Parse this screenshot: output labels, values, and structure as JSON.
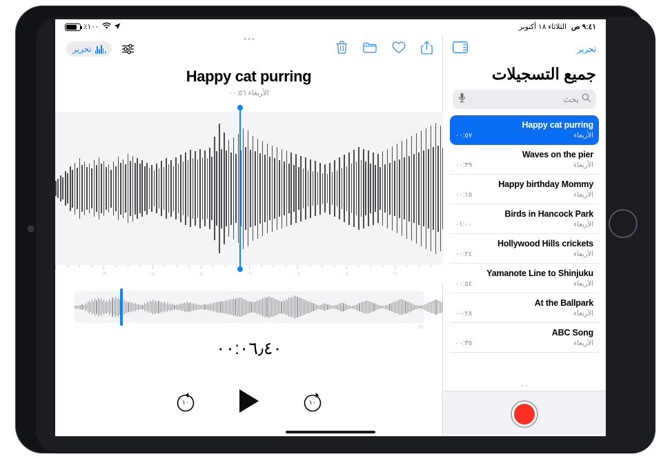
{
  "statusbar": {
    "battery_pct": "٪١٠٠",
    "wifi_icon": "wifi-icon",
    "location_icon": "location-arrow-icon",
    "date": "الثلاثاء ١٨ أكتوبر",
    "time": "٩:٤١ ص"
  },
  "player": {
    "edit_label": "تحرير",
    "edit_icon": "waveform-icon",
    "settings_icon": "audio-sliders-icon",
    "toolbar_icons": [
      {
        "name": "trash-icon",
        "label": "حذف"
      },
      {
        "name": "folder-icon",
        "label": "مجلد"
      },
      {
        "name": "heart-icon",
        "label": "مفضلة"
      },
      {
        "name": "share-icon",
        "label": "مشاركة"
      }
    ],
    "title": "Happy cat purring",
    "subtitle": "الأربعاء ٠٠:٥٦",
    "current_time": "٠٠:٠٦٫٤٠",
    "ruler_labels": [
      ":٠٣",
      ":٠٤",
      ":٠٥",
      ":٠٦",
      ":٠٧",
      ":٠٨",
      ":٠٩"
    ],
    "mini_start": "٠:٠٠",
    "mini_end": "٠:٥٦",
    "skip_back_label": "١٠",
    "skip_forward_label": "١٠",
    "play_icon": "play-icon",
    "skip_back_icon": "skip-back-10-icon",
    "skip_forward_icon": "skip-forward-10-icon",
    "playhead_pct": 47.5,
    "mini_playhead_pct": 13.0,
    "accent_color": "#0a84ff"
  },
  "sidebar": {
    "edit_label": "تحرير",
    "sidebar_toggle_icon": "sidebar-toggle-icon",
    "title": "جميع التسجيلات",
    "search_placeholder": "بحث",
    "search_icon": "search-icon",
    "dictate_icon": "microphone-icon",
    "record_button_label": "تسجيل",
    "record_color": "#fc3022",
    "selected_index": 0,
    "recordings": [
      {
        "name": "Happy cat purring",
        "day": "الأربعاء",
        "duration": "٠٠:٥٧"
      },
      {
        "name": "Waves on the pier",
        "day": "الأربعاء",
        "duration": "٠٠:٣٩"
      },
      {
        "name": "Happy birthday Mommy",
        "day": "الأربعاء",
        "duration": "٠٠:١٥"
      },
      {
        "name": "Birds in Hancock Park",
        "day": "الأربعاء",
        "duration": "٠١:٠٠"
      },
      {
        "name": "Hollywood Hills crickets",
        "day": "الأربعاء",
        "duration": "٠٠:٢٤"
      },
      {
        "name": "Yamanote Line to Shinjuku",
        "day": "الأربعاء",
        "duration": "٠٠:٥٤"
      },
      {
        "name": "At the Ballpark",
        "day": "الأربعاء",
        "duration": "٠٠:٢٨"
      },
      {
        "name": "ABC Song",
        "day": "الأربعاء",
        "duration": "٠٠:٣٥"
      }
    ]
  },
  "waveform": {
    "main_bars": [
      18,
      22,
      30,
      26,
      40,
      35,
      52,
      44,
      60,
      48,
      70,
      55,
      62,
      50,
      58,
      46,
      66,
      54,
      72,
      58,
      64,
      50,
      56,
      44,
      62,
      52,
      74,
      60,
      68,
      56,
      80,
      64,
      76,
      60,
      70,
      58,
      66,
      52,
      60,
      48,
      54,
      42,
      58,
      46,
      64,
      50,
      70,
      56,
      66,
      52,
      72,
      58,
      78,
      62,
      84,
      66,
      90,
      70,
      86,
      68,
      92,
      72,
      88,
      70,
      94,
      74,
      120,
      86,
      150,
      92,
      130,
      88,
      112,
      84,
      118,
      80,
      126,
      88,
      140,
      96,
      134,
      90,
      122,
      86,
      116,
      82,
      110,
      78,
      104,
      74,
      100,
      70,
      96,
      66,
      92,
      62,
      88,
      58,
      84,
      54,
      80,
      50,
      76,
      46,
      72,
      42,
      68,
      40,
      64,
      38,
      60,
      36,
      56,
      34,
      60,
      38,
      66,
      42,
      72,
      48,
      78,
      52,
      84,
      58,
      90,
      62,
      96,
      66,
      92,
      62,
      88,
      58,
      84,
      54,
      80,
      50,
      86,
      56,
      92,
      60,
      98,
      64,
      104,
      68,
      110,
      72,
      116,
      76,
      122,
      80,
      128,
      84,
      134,
      88,
      140,
      92,
      146,
      96,
      152,
      100,
      146,
      94,
      140,
      90,
      134,
      86,
      128,
      82,
      122,
      78,
      116,
      74,
      110,
      70,
      104,
      66,
      98,
      62,
      92,
      58,
      86,
      54,
      80,
      50,
      74,
      46,
      68,
      42,
      62,
      38,
      56,
      34,
      50,
      30,
      44,
      28,
      40,
      26,
      36,
      24,
      40,
      28,
      46,
      32,
      52,
      36,
      58,
      40,
      64,
      44,
      70,
      48,
      76,
      52,
      82,
      56,
      88,
      60,
      94,
      64,
      100,
      68,
      106,
      72,
      112,
      76,
      118,
      80,
      124,
      84,
      130,
      88,
      136,
      92,
      142,
      96,
      148,
      100,
      154,
      104,
      160,
      108,
      154,
      102,
      148,
      98,
      142,
      94,
      136,
      90,
      130,
      86,
      124,
      82,
      118,
      78,
      112,
      74,
      106,
      70,
      100,
      66,
      94,
      62,
      88,
      58,
      82,
      54,
      76,
      50,
      70,
      46,
      64,
      42,
      58,
      38,
      52,
      34,
      46,
      30,
      40,
      28,
      36,
      24,
      32,
      22,
      28,
      20,
      34,
      24,
      40,
      28,
      46,
      32,
      52,
      36,
      58,
      40,
      64,
      44,
      70,
      48,
      76,
      52,
      82,
      56,
      88,
      60,
      94,
      64,
      88,
      58,
      82,
      54,
      76,
      50,
      70,
      46,
      64,
      42,
      58,
      38,
      52,
      34,
      46,
      30,
      40,
      26,
      34,
      22,
      28,
      20,
      24,
      18,
      30,
      22,
      36,
      26,
      42,
      30,
      48,
      34,
      54,
      38,
      60,
      42,
      66,
      46,
      72,
      50,
      78,
      54,
      84,
      58,
      90,
      62,
      96,
      66,
      102,
      70,
      108,
      74,
      114,
      78,
      120,
      82,
      126,
      86,
      132,
      90,
      138,
      94,
      144,
      98,
      138,
      92,
      132,
      88,
      126,
      84,
      120,
      80,
      114,
      76,
      108,
      72,
      102,
      68,
      96,
      64,
      90,
      60,
      84,
      56,
      78,
      52,
      72,
      48,
      66,
      44,
      60,
      40,
      54,
      36,
      48,
      32,
      42,
      28,
      36,
      24,
      30,
      20,
      26,
      18,
      32,
      22,
      38,
      26,
      44,
      30,
      50,
      34,
      56,
      38,
      62,
      42,
      68,
      46,
      74,
      50,
      80,
      54,
      86,
      58,
      92,
      62,
      98,
      66,
      104,
      70,
      110,
      74,
      116,
      78,
      122,
      82,
      128,
      86,
      134,
      90,
      140,
      94,
      150,
      100,
      144,
      96,
      138,
      92,
      132,
      88,
      126,
      84,
      120,
      80,
      114,
      76,
      108,
      72,
      102,
      68,
      96,
      64,
      90,
      60,
      84,
      56,
      78,
      52,
      72,
      48,
      66,
      44,
      60,
      40,
      54,
      36,
      48,
      32,
      42,
      28,
      36,
      24,
      30,
      22,
      26,
      18,
      22,
      16,
      28,
      20,
      34,
      24,
      40,
      28,
      46,
      32,
      52,
      36,
      58,
      40,
      64,
      44,
      70,
      48,
      76,
      52,
      82,
      56,
      88,
      60,
      94,
      64,
      100,
      68,
      106,
      72,
      112,
      76,
      118,
      80,
      124,
      84,
      118,
      80,
      112,
      76,
      106,
      72,
      100,
      68,
      94,
      64,
      88,
      60,
      82,
      56,
      76,
      52,
      70,
      48,
      64,
      44,
      58,
      40,
      52,
      36,
      46,
      32,
      40,
      28
    ],
    "mini_bars": [
      4,
      6,
      5,
      8,
      6,
      10,
      8,
      14,
      10,
      18,
      22,
      16,
      26,
      20,
      30,
      24,
      34,
      26,
      30,
      22,
      26,
      20,
      24,
      18,
      28,
      22,
      32,
      26,
      36,
      28,
      34,
      26,
      30,
      24,
      26,
      20,
      22,
      16,
      18,
      14,
      16,
      12,
      14,
      10,
      12,
      8,
      10,
      8,
      14,
      12,
      18,
      14,
      22,
      18,
      26,
      20,
      24,
      18,
      22,
      16,
      20,
      14,
      18,
      12,
      16,
      10,
      14,
      10,
      12,
      8,
      10,
      8,
      12,
      10,
      14,
      12,
      16,
      14,
      18,
      14,
      16,
      12,
      14,
      10,
      12,
      8,
      10,
      7,
      8,
      6,
      10,
      8,
      12,
      10,
      14,
      12,
      16,
      14,
      18,
      16,
      20,
      18,
      22,
      20,
      24,
      22,
      26,
      24,
      28,
      26,
      30,
      28,
      32,
      30,
      34,
      32,
      30,
      28,
      26,
      24,
      22,
      20,
      18,
      16,
      20,
      18,
      24,
      22,
      28,
      26,
      32,
      30,
      36,
      34,
      38,
      36,
      34,
      32,
      30,
      28,
      26,
      24,
      22,
      20,
      24,
      22,
      28,
      26,
      32,
      30,
      36,
      34,
      40,
      38,
      36,
      34,
      32,
      30,
      28,
      26,
      24,
      22,
      20,
      18,
      16,
      14,
      12,
      10,
      8,
      6,
      8,
      10,
      12,
      14,
      12,
      10,
      8,
      6,
      5,
      4,
      6,
      8,
      10,
      12,
      14,
      16,
      14,
      12,
      10,
      8,
      6,
      5,
      4,
      6,
      8,
      10,
      12,
      14,
      16,
      18,
      20,
      22,
      24,
      22,
      20,
      18,
      16,
      14,
      12,
      10,
      8,
      6,
      5,
      4,
      5,
      6,
      8,
      10,
      12,
      14,
      16,
      18,
      20,
      22,
      24,
      26,
      28,
      26,
      24,
      22,
      20,
      18,
      16,
      14,
      12,
      10,
      8,
      6,
      5,
      4,
      6,
      8,
      10,
      12,
      14,
      16,
      18,
      20,
      22,
      24,
      26,
      24,
      22,
      20,
      18,
      16,
      14,
      12,
      10,
      8,
      6,
      5,
      4,
      6,
      8,
      10,
      12,
      14,
      16,
      18,
      20,
      18,
      16,
      14,
      12,
      10,
      8,
      6,
      5,
      4,
      3,
      4,
      5,
      6,
      8,
      10,
      12,
      14,
      16,
      18,
      20,
      22,
      24,
      26,
      28,
      30,
      28,
      26,
      24,
      22,
      20,
      18,
      16,
      14,
      12,
      10,
      8,
      6,
      5,
      4,
      3,
      4,
      6,
      8,
      10,
      12,
      14,
      16,
      18,
      20,
      22,
      24,
      22,
      20,
      18,
      16,
      14,
      12,
      10,
      8,
      6,
      5,
      4,
      3,
      4,
      6,
      8,
      10,
      12,
      14,
      16,
      18,
      20,
      22,
      24,
      26,
      28,
      30,
      32,
      30,
      28,
      26,
      24,
      22,
      20,
      18,
      16,
      14,
      12,
      10,
      8,
      6,
      5,
      4,
      3,
      4,
      5,
      6,
      8,
      10,
      12,
      10,
      8,
      6,
      5,
      4,
      3,
      4,
      6,
      8,
      10,
      12,
      14,
      16,
      18,
      16,
      14,
      12,
      10,
      8,
      6,
      5,
      4,
      3
    ]
  }
}
